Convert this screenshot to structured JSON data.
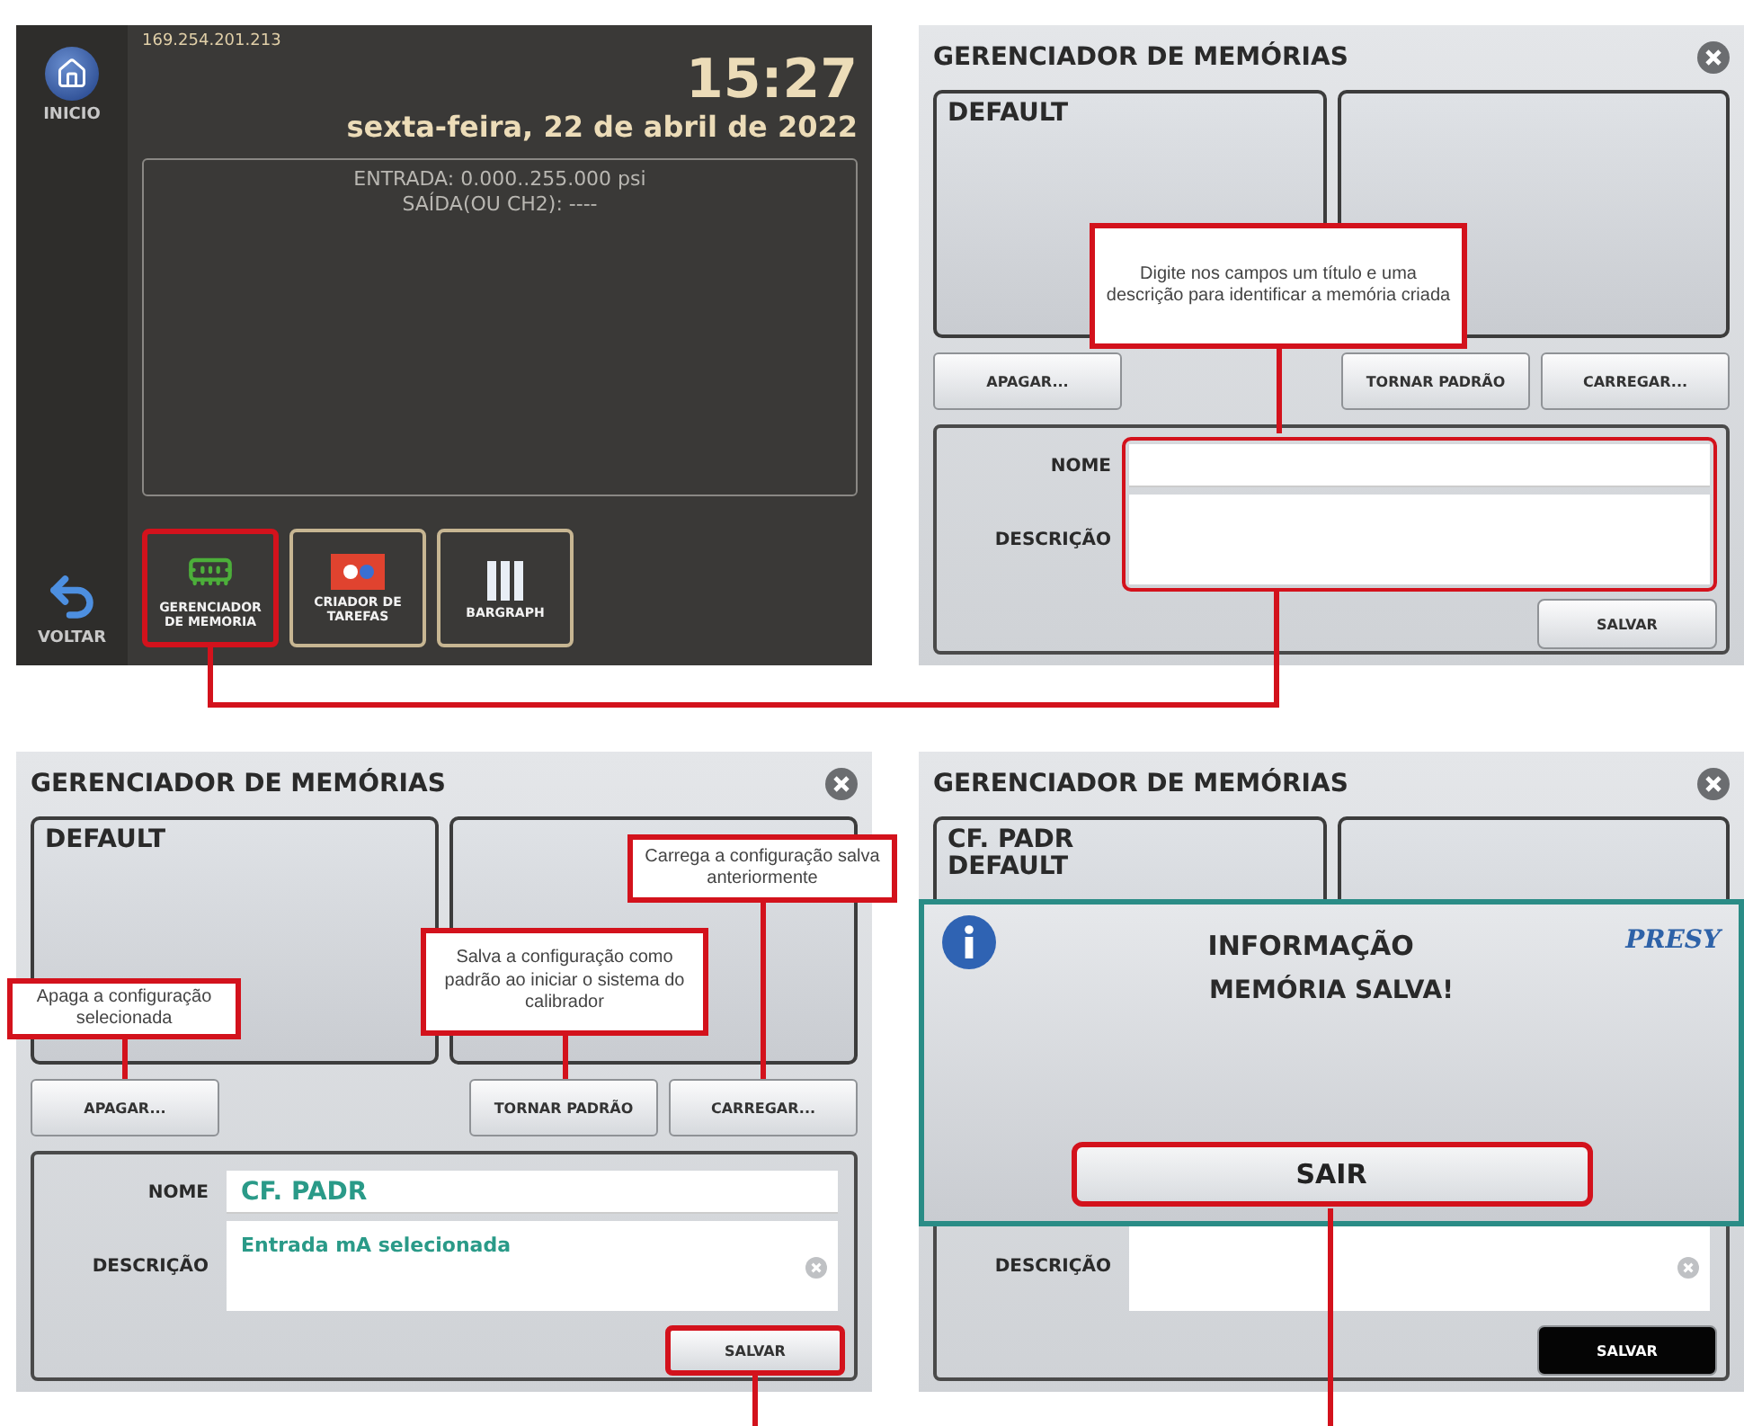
{
  "home_screen": {
    "ip_address": "169.254.201.213",
    "time": "15:27",
    "date": "sexta-feira, 22 de abril de 2022",
    "nav": [
      {
        "kind": "home",
        "label": "INICIO"
      },
      {
        "kind": "back",
        "label": "VOLTAR"
      }
    ],
    "status_lines": [
      "ENTRADA: 0.000..255.000 psi",
      "SAÍDA(OU CH2): ----"
    ],
    "apps": [
      {
        "kind": "memory",
        "label": "GERENCIADOR DE MEMORIA",
        "highlighted": true
      },
      {
        "kind": "tasks",
        "label": "CRIADOR DE TAREFAS",
        "highlighted": false
      },
      {
        "kind": "bargraph",
        "label": "BARGRAPH",
        "highlighted": false
      }
    ]
  },
  "memory_screens": [
    {
      "title": "GERENCIADOR DE MEMÓRIAS",
      "slots": [
        {
          "kind": "list",
          "entries": [
            "DEFAULT"
          ]
        },
        {
          "kind": "empty"
        }
      ],
      "buttons": [
        "APAGAR...",
        "TORNAR PADRÃO",
        "CARREGAR..."
      ],
      "form": {
        "name_label": "NOME",
        "description_label": "DESCRIÇÃO",
        "fields_highlighted": true,
        "clear_button": false,
        "save": {
          "label": "SALVAR",
          "highlighted": false,
          "pressed": false
        }
      },
      "callouts": [
        {
          "kind": "fields",
          "text": "Digite nos campos um título e uma descrição para identificar a memória criada"
        }
      ]
    },
    {
      "title": "GERENCIADOR DE MEMÓRIAS",
      "slots": [
        {
          "kind": "list",
          "entries": [
            "DEFAULT"
          ]
        },
        {
          "kind": "empty"
        }
      ],
      "buttons": [
        "APAGAR...",
        "TORNAR PADRÃO",
        "CARREGAR..."
      ],
      "form": {
        "name_label": "NOME",
        "name_value": "CF. PADR",
        "description_label": "DESCRIÇÃO",
        "description_value": "Entrada mA selecionada",
        "fields_highlighted": false,
        "clear_button": true,
        "save": {
          "label": "SALVAR",
          "highlighted": true,
          "pressed": false
        }
      },
      "callouts": [
        {
          "kind": "delete",
          "text": "Apaga a configuração selecionada"
        },
        {
          "kind": "default",
          "text": "Salva a configuração como padrão ao iniciar o sistema do calibrador"
        },
        {
          "kind": "load",
          "text": "Carrega a configuração salva anteriormente"
        }
      ]
    },
    {
      "title": "GERENCIADOR DE MEMÓRIAS",
      "slots": [
        {
          "kind": "list",
          "entries": [
            "CF. PADR",
            "DEFAULT"
          ]
        },
        {
          "kind": "empty"
        }
      ],
      "form": {
        "description_label": "DESCRIÇÃO",
        "fields_highlighted": false,
        "clear_button": true,
        "save": {
          "label": "SALVAR",
          "highlighted": false,
          "pressed": true
        }
      },
      "dialog": {
        "title": "INFORMAÇÃO",
        "message": "MEMÓRIA SALVA!",
        "brand": "PRESY",
        "button": {
          "label": "SAIR",
          "highlighted": true
        }
      }
    }
  ]
}
